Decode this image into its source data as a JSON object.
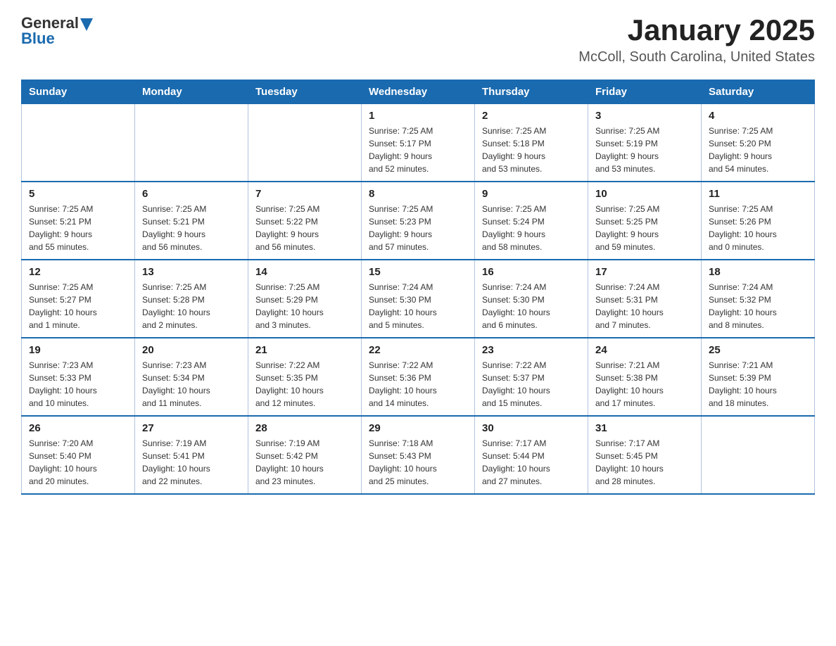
{
  "logo": {
    "text_general": "General",
    "text_blue": "Blue",
    "arrow": "▲"
  },
  "title": "January 2025",
  "subtitle": "McColl, South Carolina, United States",
  "headers": [
    "Sunday",
    "Monday",
    "Tuesday",
    "Wednesday",
    "Thursday",
    "Friday",
    "Saturday"
  ],
  "weeks": [
    [
      {
        "day": "",
        "info": ""
      },
      {
        "day": "",
        "info": ""
      },
      {
        "day": "",
        "info": ""
      },
      {
        "day": "1",
        "info": "Sunrise: 7:25 AM\nSunset: 5:17 PM\nDaylight: 9 hours\nand 52 minutes."
      },
      {
        "day": "2",
        "info": "Sunrise: 7:25 AM\nSunset: 5:18 PM\nDaylight: 9 hours\nand 53 minutes."
      },
      {
        "day": "3",
        "info": "Sunrise: 7:25 AM\nSunset: 5:19 PM\nDaylight: 9 hours\nand 53 minutes."
      },
      {
        "day": "4",
        "info": "Sunrise: 7:25 AM\nSunset: 5:20 PM\nDaylight: 9 hours\nand 54 minutes."
      }
    ],
    [
      {
        "day": "5",
        "info": "Sunrise: 7:25 AM\nSunset: 5:21 PM\nDaylight: 9 hours\nand 55 minutes."
      },
      {
        "day": "6",
        "info": "Sunrise: 7:25 AM\nSunset: 5:21 PM\nDaylight: 9 hours\nand 56 minutes."
      },
      {
        "day": "7",
        "info": "Sunrise: 7:25 AM\nSunset: 5:22 PM\nDaylight: 9 hours\nand 56 minutes."
      },
      {
        "day": "8",
        "info": "Sunrise: 7:25 AM\nSunset: 5:23 PM\nDaylight: 9 hours\nand 57 minutes."
      },
      {
        "day": "9",
        "info": "Sunrise: 7:25 AM\nSunset: 5:24 PM\nDaylight: 9 hours\nand 58 minutes."
      },
      {
        "day": "10",
        "info": "Sunrise: 7:25 AM\nSunset: 5:25 PM\nDaylight: 9 hours\nand 59 minutes."
      },
      {
        "day": "11",
        "info": "Sunrise: 7:25 AM\nSunset: 5:26 PM\nDaylight: 10 hours\nand 0 minutes."
      }
    ],
    [
      {
        "day": "12",
        "info": "Sunrise: 7:25 AM\nSunset: 5:27 PM\nDaylight: 10 hours\nand 1 minute."
      },
      {
        "day": "13",
        "info": "Sunrise: 7:25 AM\nSunset: 5:28 PM\nDaylight: 10 hours\nand 2 minutes."
      },
      {
        "day": "14",
        "info": "Sunrise: 7:25 AM\nSunset: 5:29 PM\nDaylight: 10 hours\nand 3 minutes."
      },
      {
        "day": "15",
        "info": "Sunrise: 7:24 AM\nSunset: 5:30 PM\nDaylight: 10 hours\nand 5 minutes."
      },
      {
        "day": "16",
        "info": "Sunrise: 7:24 AM\nSunset: 5:30 PM\nDaylight: 10 hours\nand 6 minutes."
      },
      {
        "day": "17",
        "info": "Sunrise: 7:24 AM\nSunset: 5:31 PM\nDaylight: 10 hours\nand 7 minutes."
      },
      {
        "day": "18",
        "info": "Sunrise: 7:24 AM\nSunset: 5:32 PM\nDaylight: 10 hours\nand 8 minutes."
      }
    ],
    [
      {
        "day": "19",
        "info": "Sunrise: 7:23 AM\nSunset: 5:33 PM\nDaylight: 10 hours\nand 10 minutes."
      },
      {
        "day": "20",
        "info": "Sunrise: 7:23 AM\nSunset: 5:34 PM\nDaylight: 10 hours\nand 11 minutes."
      },
      {
        "day": "21",
        "info": "Sunrise: 7:22 AM\nSunset: 5:35 PM\nDaylight: 10 hours\nand 12 minutes."
      },
      {
        "day": "22",
        "info": "Sunrise: 7:22 AM\nSunset: 5:36 PM\nDaylight: 10 hours\nand 14 minutes."
      },
      {
        "day": "23",
        "info": "Sunrise: 7:22 AM\nSunset: 5:37 PM\nDaylight: 10 hours\nand 15 minutes."
      },
      {
        "day": "24",
        "info": "Sunrise: 7:21 AM\nSunset: 5:38 PM\nDaylight: 10 hours\nand 17 minutes."
      },
      {
        "day": "25",
        "info": "Sunrise: 7:21 AM\nSunset: 5:39 PM\nDaylight: 10 hours\nand 18 minutes."
      }
    ],
    [
      {
        "day": "26",
        "info": "Sunrise: 7:20 AM\nSunset: 5:40 PM\nDaylight: 10 hours\nand 20 minutes."
      },
      {
        "day": "27",
        "info": "Sunrise: 7:19 AM\nSunset: 5:41 PM\nDaylight: 10 hours\nand 22 minutes."
      },
      {
        "day": "28",
        "info": "Sunrise: 7:19 AM\nSunset: 5:42 PM\nDaylight: 10 hours\nand 23 minutes."
      },
      {
        "day": "29",
        "info": "Sunrise: 7:18 AM\nSunset: 5:43 PM\nDaylight: 10 hours\nand 25 minutes."
      },
      {
        "day": "30",
        "info": "Sunrise: 7:17 AM\nSunset: 5:44 PM\nDaylight: 10 hours\nand 27 minutes."
      },
      {
        "day": "31",
        "info": "Sunrise: 7:17 AM\nSunset: 5:45 PM\nDaylight: 10 hours\nand 28 minutes."
      },
      {
        "day": "",
        "info": ""
      }
    ]
  ]
}
